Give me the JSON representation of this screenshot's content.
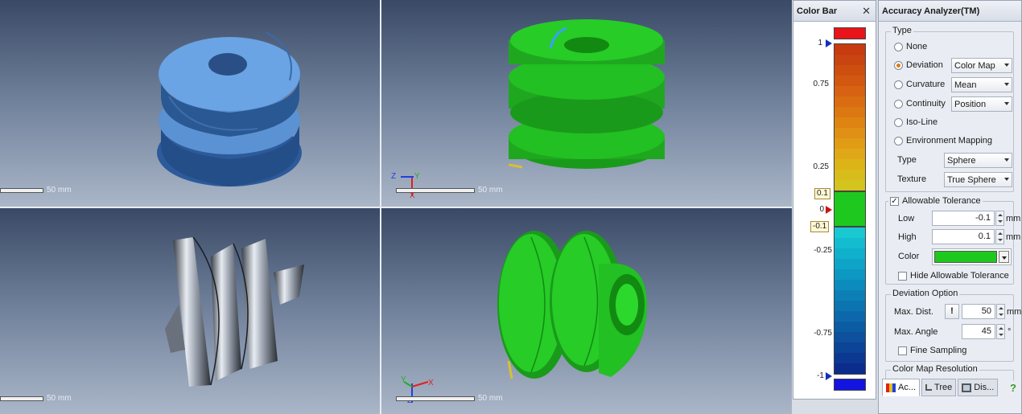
{
  "viewports": {
    "scale_label": "50 mm",
    "axes": {
      "x": "X",
      "y": "Y",
      "z": "Z"
    }
  },
  "colorbar": {
    "title": "Color Bar",
    "close_icon": "close-icon",
    "labels": [
      "1",
      "0.75",
      "0.25",
      "0",
      "-0.25",
      "-0.75",
      "-1"
    ],
    "tolerance_high": "0.1",
    "tolerance_low": "-0.1",
    "colors": {
      "over": "#e8141a",
      "under": "#1414e0",
      "tolerance": "#1ec81e",
      "marker_ends": "#1030c0",
      "marker_zero": "#d01010"
    },
    "positive_steps": [
      "#c83a10",
      "#c84410",
      "#ce4e10",
      "#d25810",
      "#d66212",
      "#da6c12",
      "#dc7812",
      "#de8412",
      "#e09014",
      "#e09c14",
      "#e0a818",
      "#dcb418",
      "#d8bc1c",
      "#d4c41e"
    ],
    "negative_steps": [
      "#1ac8d2",
      "#14bcd0",
      "#10b0cc",
      "#0ea4c8",
      "#0c98c2",
      "#0c8cbc",
      "#0c80b6",
      "#0c74b0",
      "#0c68aa",
      "#0c5ca4",
      "#0c509e",
      "#0c4498",
      "#0c3892",
      "#0c2c8c"
    ]
  },
  "analyzer": {
    "title": "Accuracy Analyzer(TM)",
    "type_group": {
      "title": "Type",
      "none": "None",
      "deviation": "Deviation",
      "deviation_mode": "Color Map",
      "curvature": "Curvature",
      "curvature_mode": "Mean",
      "continuity": "Continuity",
      "continuity_mode": "Position",
      "isoline": "Iso-Line",
      "env_mapping": "Environment Mapping",
      "env_type_label": "Type",
      "env_type": "Sphere",
      "texture_label": "Texture",
      "texture": "True Sphere"
    },
    "tolerance_group": {
      "title": "Allowable Tolerance",
      "low_label": "Low",
      "low_value": "-0.1",
      "high_label": "High",
      "high_value": "0.1",
      "unit": "mm",
      "color_label": "Color",
      "color": "#1ec81e",
      "hide_label": "Hide Allowable Tolerance"
    },
    "deviation_group": {
      "title": "Deviation Option",
      "max_dist_label": "Max. Dist.",
      "max_dist_value": "50",
      "max_dist_unit": "mm",
      "max_angle_label": "Max. Angle",
      "max_angle_value": "45",
      "max_angle_unit": "°",
      "fine_sampling_label": "Fine Sampling",
      "warn_button": "!"
    },
    "resolution_group": {
      "title": "Color Map Resolution"
    },
    "tabs": [
      {
        "label": "Ac..."
      },
      {
        "label": "Tree"
      },
      {
        "label": "Dis..."
      }
    ],
    "help": "?"
  }
}
